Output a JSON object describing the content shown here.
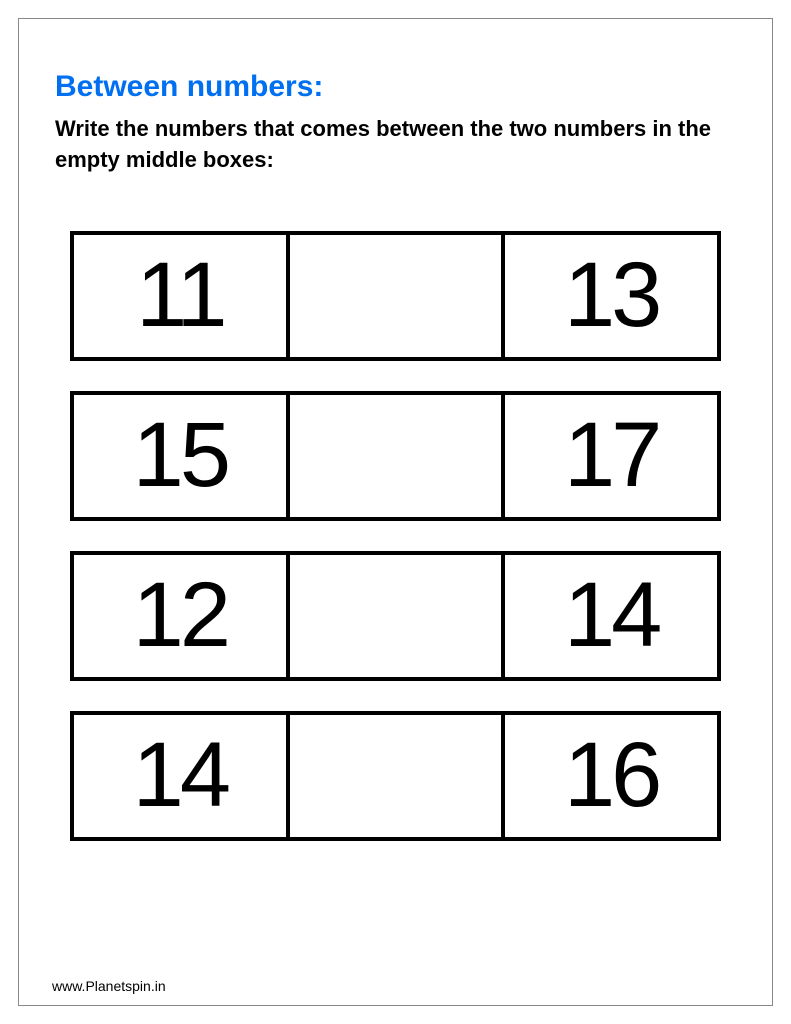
{
  "title": "Between numbers:",
  "instruction": "Write the numbers that comes between the two numbers in the empty middle boxes:",
  "rows": [
    {
      "left": "11",
      "middle": "",
      "right": "13"
    },
    {
      "left": "15",
      "middle": "",
      "right": "17"
    },
    {
      "left": "12",
      "middle": "",
      "right": "14"
    },
    {
      "left": "14",
      "middle": "",
      "right": "16"
    }
  ],
  "footer": "www.Planetspin.in"
}
